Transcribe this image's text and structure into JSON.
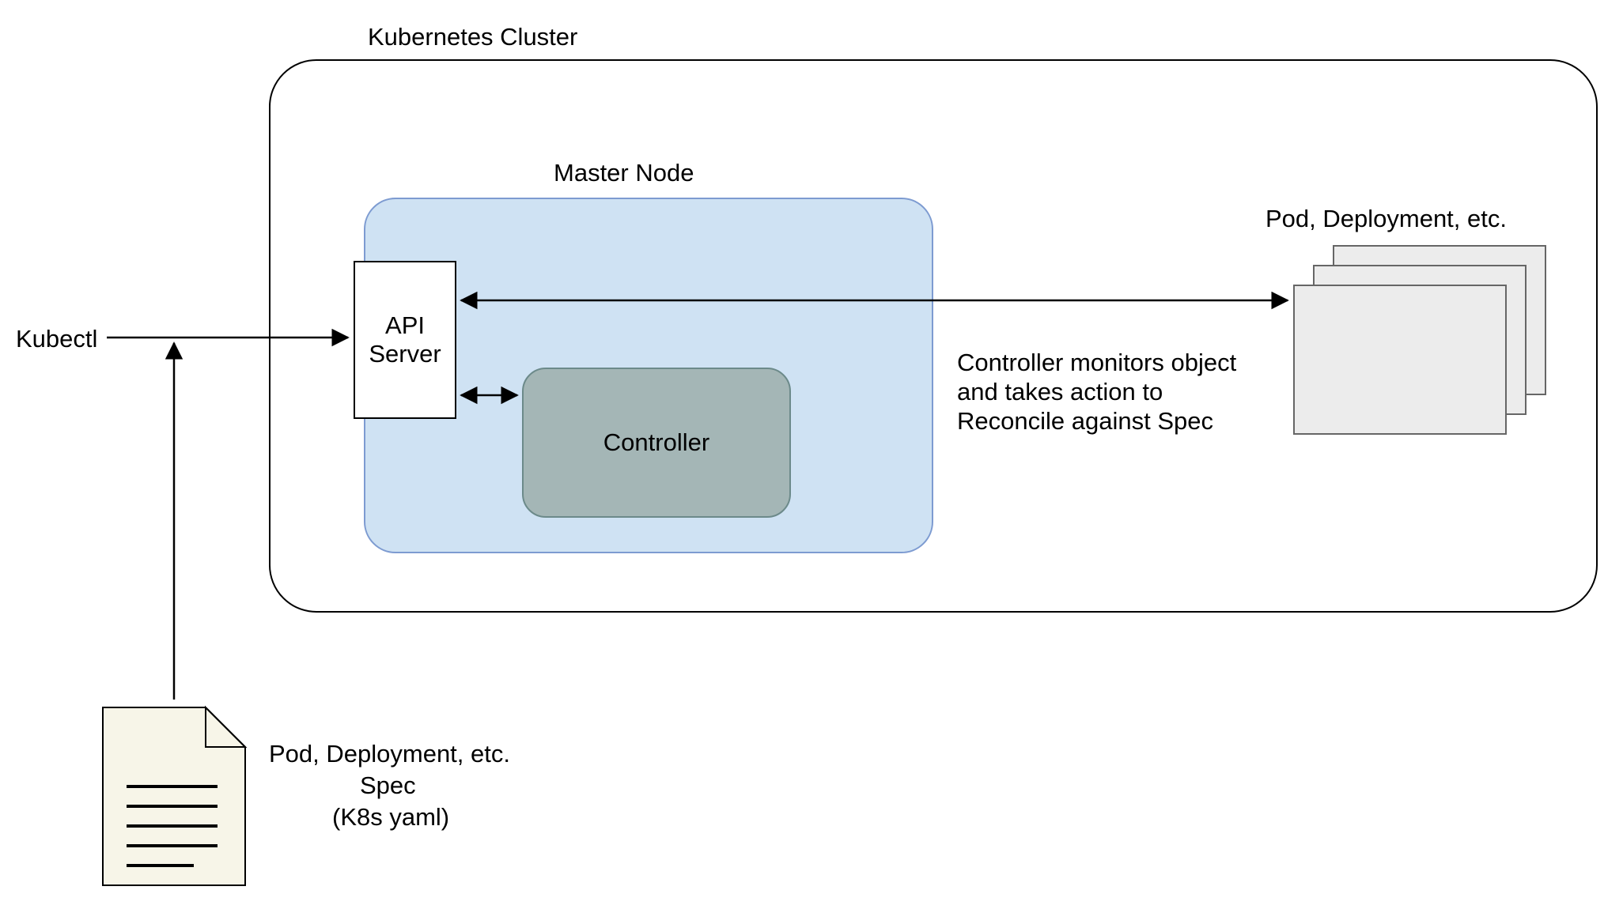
{
  "labels": {
    "kubectl": "Kubectl",
    "cluster": "Kubernetes Cluster",
    "master": "Master Node",
    "api": "API Server",
    "controller": "Controller",
    "pods_header": "Pod, Deployment, etc.",
    "controller_note": "Controller monitors object and takes action to Reconcile against Spec",
    "spec_line1": "Pod, Deployment, etc.",
    "spec_line2": "Spec",
    "spec_line3": "(K8s yaml)"
  }
}
